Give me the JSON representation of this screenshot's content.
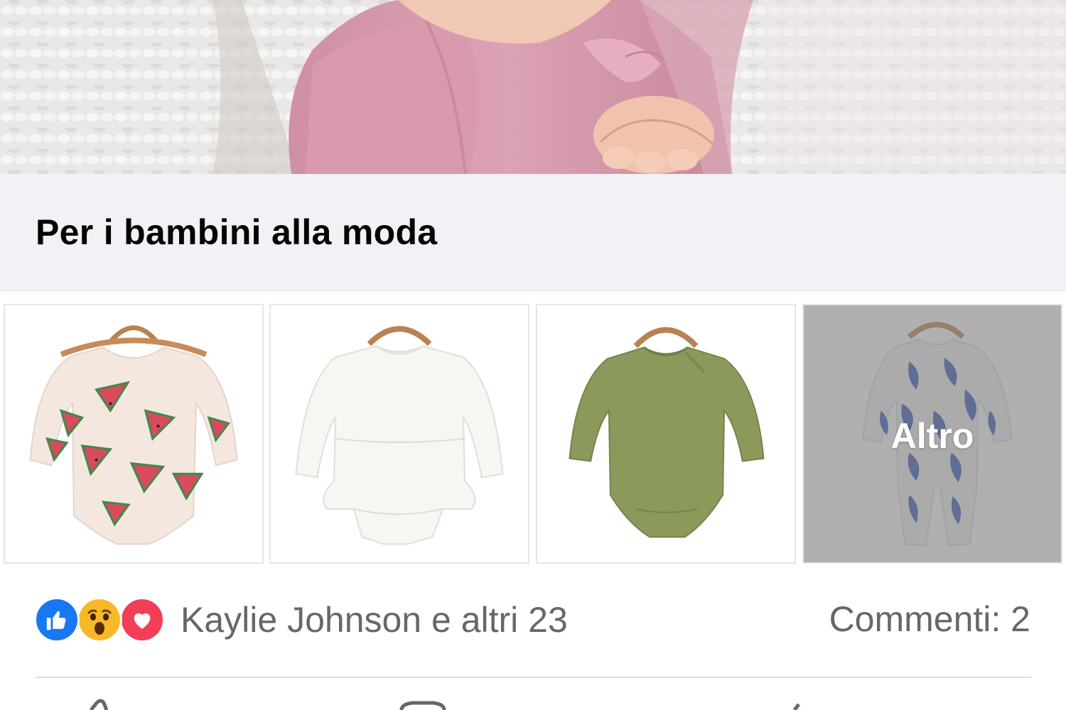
{
  "post": {
    "hero_image_alt": "baby-photo",
    "collection_title": "Per i bambini alla moda",
    "products": [
      {
        "name": "watermelon-onesie"
      },
      {
        "name": "white-dress-onesie"
      },
      {
        "name": "olive-onesie"
      },
      {
        "name": "blue-print-sleeper",
        "overlay_label": "Altro"
      }
    ],
    "reactions": {
      "icons": [
        "like-icon",
        "wow-icon",
        "love-icon"
      ],
      "summary": "Kaylie Johnson e altri 23"
    },
    "comments_label": "Commenti: 2"
  },
  "colors": {
    "like": "#1877f2",
    "wow": "#f7b928",
    "love": "#f33e58",
    "caption_bg": "#f0f2f5",
    "muted_text": "#65676b"
  }
}
